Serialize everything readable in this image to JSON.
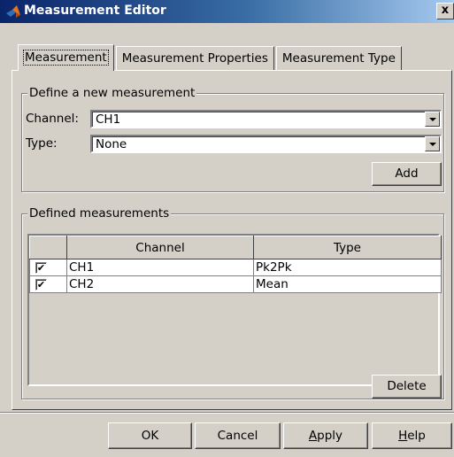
{
  "window": {
    "title": "Measurement Editor",
    "close_label": "x"
  },
  "tabs": [
    {
      "label": "Measurement"
    },
    {
      "label": "Measurement Properties"
    },
    {
      "label": "Measurement Type"
    }
  ],
  "define_group": {
    "title": "Define a new measurement",
    "channel_label": "Channel:",
    "channel_value": "CH1",
    "type_label": "Type:",
    "type_value": "None",
    "add_label": "Add"
  },
  "defined_group": {
    "title": "Defined measurements",
    "columns": [
      "Channel",
      "Type"
    ],
    "rows": [
      {
        "checked": true,
        "channel": "CH1",
        "type": "Pk2Pk"
      },
      {
        "checked": true,
        "channel": "CH2",
        "type": "Mean"
      }
    ],
    "delete_label": "Delete"
  },
  "footer": {
    "ok_label": "OK",
    "cancel_label": "Cancel",
    "apply_mnemonic": "A",
    "apply_rest": "pply",
    "help_mnemonic": "H",
    "help_rest": "elp"
  },
  "checkmark": "✔"
}
